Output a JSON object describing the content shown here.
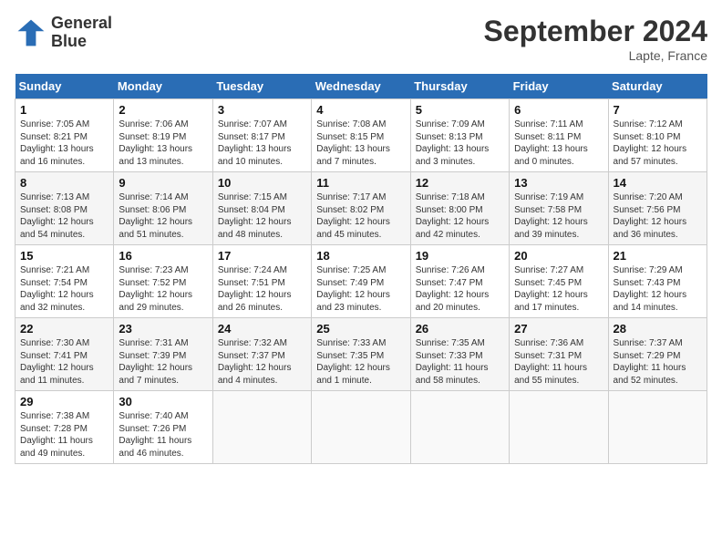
{
  "header": {
    "logo_line1": "General",
    "logo_line2": "Blue",
    "month_title": "September 2024",
    "location": "Lapte, France"
  },
  "days_of_week": [
    "Sunday",
    "Monday",
    "Tuesday",
    "Wednesday",
    "Thursday",
    "Friday",
    "Saturday"
  ],
  "weeks": [
    [
      {
        "num": "1",
        "sunrise": "Sunrise: 7:05 AM",
        "sunset": "Sunset: 8:21 PM",
        "daylight": "Daylight: 13 hours and 16 minutes."
      },
      {
        "num": "2",
        "sunrise": "Sunrise: 7:06 AM",
        "sunset": "Sunset: 8:19 PM",
        "daylight": "Daylight: 13 hours and 13 minutes."
      },
      {
        "num": "3",
        "sunrise": "Sunrise: 7:07 AM",
        "sunset": "Sunset: 8:17 PM",
        "daylight": "Daylight: 13 hours and 10 minutes."
      },
      {
        "num": "4",
        "sunrise": "Sunrise: 7:08 AM",
        "sunset": "Sunset: 8:15 PM",
        "daylight": "Daylight: 13 hours and 7 minutes."
      },
      {
        "num": "5",
        "sunrise": "Sunrise: 7:09 AM",
        "sunset": "Sunset: 8:13 PM",
        "daylight": "Daylight: 13 hours and 3 minutes."
      },
      {
        "num": "6",
        "sunrise": "Sunrise: 7:11 AM",
        "sunset": "Sunset: 8:11 PM",
        "daylight": "Daylight: 13 hours and 0 minutes."
      },
      {
        "num": "7",
        "sunrise": "Sunrise: 7:12 AM",
        "sunset": "Sunset: 8:10 PM",
        "daylight": "Daylight: 12 hours and 57 minutes."
      }
    ],
    [
      {
        "num": "8",
        "sunrise": "Sunrise: 7:13 AM",
        "sunset": "Sunset: 8:08 PM",
        "daylight": "Daylight: 12 hours and 54 minutes."
      },
      {
        "num": "9",
        "sunrise": "Sunrise: 7:14 AM",
        "sunset": "Sunset: 8:06 PM",
        "daylight": "Daylight: 12 hours and 51 minutes."
      },
      {
        "num": "10",
        "sunrise": "Sunrise: 7:15 AM",
        "sunset": "Sunset: 8:04 PM",
        "daylight": "Daylight: 12 hours and 48 minutes."
      },
      {
        "num": "11",
        "sunrise": "Sunrise: 7:17 AM",
        "sunset": "Sunset: 8:02 PM",
        "daylight": "Daylight: 12 hours and 45 minutes."
      },
      {
        "num": "12",
        "sunrise": "Sunrise: 7:18 AM",
        "sunset": "Sunset: 8:00 PM",
        "daylight": "Daylight: 12 hours and 42 minutes."
      },
      {
        "num": "13",
        "sunrise": "Sunrise: 7:19 AM",
        "sunset": "Sunset: 7:58 PM",
        "daylight": "Daylight: 12 hours and 39 minutes."
      },
      {
        "num": "14",
        "sunrise": "Sunrise: 7:20 AM",
        "sunset": "Sunset: 7:56 PM",
        "daylight": "Daylight: 12 hours and 36 minutes."
      }
    ],
    [
      {
        "num": "15",
        "sunrise": "Sunrise: 7:21 AM",
        "sunset": "Sunset: 7:54 PM",
        "daylight": "Daylight: 12 hours and 32 minutes."
      },
      {
        "num": "16",
        "sunrise": "Sunrise: 7:23 AM",
        "sunset": "Sunset: 7:52 PM",
        "daylight": "Daylight: 12 hours and 29 minutes."
      },
      {
        "num": "17",
        "sunrise": "Sunrise: 7:24 AM",
        "sunset": "Sunset: 7:51 PM",
        "daylight": "Daylight: 12 hours and 26 minutes."
      },
      {
        "num": "18",
        "sunrise": "Sunrise: 7:25 AM",
        "sunset": "Sunset: 7:49 PM",
        "daylight": "Daylight: 12 hours and 23 minutes."
      },
      {
        "num": "19",
        "sunrise": "Sunrise: 7:26 AM",
        "sunset": "Sunset: 7:47 PM",
        "daylight": "Daylight: 12 hours and 20 minutes."
      },
      {
        "num": "20",
        "sunrise": "Sunrise: 7:27 AM",
        "sunset": "Sunset: 7:45 PM",
        "daylight": "Daylight: 12 hours and 17 minutes."
      },
      {
        "num": "21",
        "sunrise": "Sunrise: 7:29 AM",
        "sunset": "Sunset: 7:43 PM",
        "daylight": "Daylight: 12 hours and 14 minutes."
      }
    ],
    [
      {
        "num": "22",
        "sunrise": "Sunrise: 7:30 AM",
        "sunset": "Sunset: 7:41 PM",
        "daylight": "Daylight: 12 hours and 11 minutes."
      },
      {
        "num": "23",
        "sunrise": "Sunrise: 7:31 AM",
        "sunset": "Sunset: 7:39 PM",
        "daylight": "Daylight: 12 hours and 7 minutes."
      },
      {
        "num": "24",
        "sunrise": "Sunrise: 7:32 AM",
        "sunset": "Sunset: 7:37 PM",
        "daylight": "Daylight: 12 hours and 4 minutes."
      },
      {
        "num": "25",
        "sunrise": "Sunrise: 7:33 AM",
        "sunset": "Sunset: 7:35 PM",
        "daylight": "Daylight: 12 hours and 1 minute."
      },
      {
        "num": "26",
        "sunrise": "Sunrise: 7:35 AM",
        "sunset": "Sunset: 7:33 PM",
        "daylight": "Daylight: 11 hours and 58 minutes."
      },
      {
        "num": "27",
        "sunrise": "Sunrise: 7:36 AM",
        "sunset": "Sunset: 7:31 PM",
        "daylight": "Daylight: 11 hours and 55 minutes."
      },
      {
        "num": "28",
        "sunrise": "Sunrise: 7:37 AM",
        "sunset": "Sunset: 7:29 PM",
        "daylight": "Daylight: 11 hours and 52 minutes."
      }
    ],
    [
      {
        "num": "29",
        "sunrise": "Sunrise: 7:38 AM",
        "sunset": "Sunset: 7:28 PM",
        "daylight": "Daylight: 11 hours and 49 minutes."
      },
      {
        "num": "30",
        "sunrise": "Sunrise: 7:40 AM",
        "sunset": "Sunset: 7:26 PM",
        "daylight": "Daylight: 11 hours and 46 minutes."
      },
      null,
      null,
      null,
      null,
      null
    ]
  ]
}
